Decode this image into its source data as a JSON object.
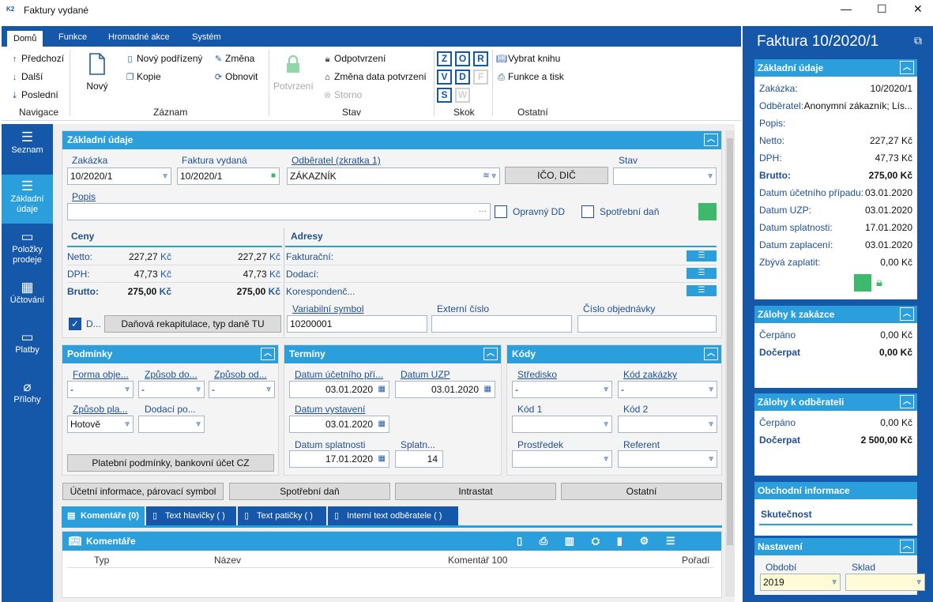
{
  "window": {
    "title": "Faktury vydané",
    "app_icon": "K2",
    "min": "—",
    "max": "☐",
    "close": "✕"
  },
  "ribbon": {
    "tabs": [
      "Domů",
      "Funkce",
      "Hromadné akce",
      "Systém"
    ],
    "nav": {
      "prev": "Předchozí",
      "next": "Další",
      "last": "Poslední",
      "group": "Navigace"
    },
    "record": {
      "new": "Nový",
      "new_sub": "Nový podřízený",
      "copy": "Kopie",
      "change": "Změna",
      "refresh": "Obnovit",
      "group": "Záznam"
    },
    "state": {
      "confirm": "Potvrzení",
      "unconfirm": "Odpotvrzení",
      "change_date": "Změna data potvrzení",
      "storno": "Storno",
      "group": "Stav"
    },
    "step": {
      "letters": [
        "Z",
        "O",
        "R",
        "V",
        "D",
        "F",
        "S",
        "W"
      ],
      "group": "Skok"
    },
    "other": {
      "choose_book": "Vybrat knihu",
      "func_print": "Funkce a tisk",
      "group": "Ostatní"
    }
  },
  "leftnav": [
    {
      "label": "Seznam",
      "icon": "☰"
    },
    {
      "label": "Základní údaje",
      "icon": "☰"
    },
    {
      "label": "Položky prodeje",
      "icon": "▭"
    },
    {
      "label": "Účtování",
      "icon": "▦"
    },
    {
      "label": "Platby",
      "icon": "▭"
    },
    {
      "label": "Přílohy",
      "icon": "⌀"
    }
  ],
  "basic": {
    "header": "Základní údaje",
    "zakazka_label": "Zakázka",
    "zakazka": "10/2020/1",
    "faktura_label": "Faktura vydaná",
    "faktura": "10/2020/1",
    "odberatel_label": "Odběratel (zkratka 1)",
    "odberatel": "ZÁKAZNÍK",
    "ico_btn": "IČO, DIČ",
    "stav_label": "Stav",
    "stav": "",
    "popis_label": "Popis",
    "popis": "",
    "opravny": "Opravný DD",
    "spotrebni": "Spotřební daň",
    "ceny": "Ceny",
    "adresy": "Adresy",
    "prices": [
      {
        "k": "Netto:",
        "v1": "227,27",
        "v2": "227,27"
      },
      {
        "k": "DPH:",
        "v1": "47,73",
        "v2": "47,73"
      },
      {
        "k": "Brutto:",
        "v1": "275,00",
        "v2": "275,00"
      }
    ],
    "currency": "Kč",
    "addresses": [
      "Fakturační:",
      "Dodací:",
      "Korespondenč..."
    ],
    "d_label": "D...",
    "rekap_btn": "Daňová rekapitulace, typ daně TU",
    "vs_label": "Variabilní symbol",
    "vs": "10200001",
    "ext_label": "Externí číslo",
    "ext": "",
    "obj_label": "Číslo objednávky",
    "obj": ""
  },
  "podminky": {
    "header": "Podmínky",
    "forma_label": "Forma obje...",
    "forma": "-",
    "zpusob_do_label": "Způsob do...",
    "zpusob_do": "-",
    "zpusob_od_label": "Způsob od...",
    "zpusob_od": "-",
    "zpusob_pl_label": "Způsob pla...",
    "zpusob_pl": "Hotově",
    "dodaci_label": "Dodací po...",
    "dodaci": "",
    "btn": "Platební podmínky, bankovní účet CZ"
  },
  "terminy": {
    "header": "Termíny",
    "ucet_label": "Datum účetního pří...",
    "ucet": "03.01.2020",
    "uzp_label": "Datum UZP",
    "uzp": "03.01.2020",
    "vyst_label": "Datum vystavení",
    "vyst": "03.01.2020",
    "spl_label": "Datum splatnosti",
    "spl": "17.01.2020",
    "splatn_label": "Splatn...",
    "splatn": "14"
  },
  "kody": {
    "header": "Kódy",
    "stredisko_label": "Středisko",
    "stredisko": "-",
    "kod_zak_label": "Kód zakázky",
    "kod_zak": "-",
    "kod1_label": "Kód 1",
    "kod1": "",
    "kod2_label": "Kód 2",
    "kod2": "",
    "prostredek_label": "Prostředek",
    "prostredek": "",
    "referent_label": "Referent",
    "referent": ""
  },
  "buttons": {
    "ucetni": "Účetní informace, párovací symbol",
    "spotrebni": "Spotřební daň",
    "intrastat": "Intrastat",
    "ostatni": "Ostatní"
  },
  "tabs": [
    "Komentáře (0)",
    "Text hlavičky ( )",
    "Text patičky ( )",
    "Interní text odběratele ( )"
  ],
  "comments": {
    "header": "Komentáře",
    "cols": [
      "Typ",
      "Název",
      "Komentář 100",
      "Pořadí"
    ]
  },
  "right": {
    "title": "Faktura 10/2020/1",
    "basic_header": "Základní údaje",
    "rows": [
      {
        "k": "Zakázka:",
        "v": "10/2020/1"
      },
      {
        "k": "Odběratel:",
        "v": "Anonymní zákazník; Lís..."
      },
      {
        "k": "Popis:",
        "v": ""
      },
      {
        "k": "Netto:",
        "v": "227,27 Kč"
      },
      {
        "k": "DPH:",
        "v": "47,73 Kč"
      },
      {
        "k": "Brutto:",
        "v": "275,00 Kč",
        "b": true
      },
      {
        "k": "Datum účetního případu:",
        "v": "03.01.2020"
      },
      {
        "k": "Datum UZP:",
        "v": "03.01.2020"
      },
      {
        "k": "Datum splatnosti:",
        "v": "17.01.2020"
      },
      {
        "k": "Datum zaplacení:",
        "v": "03.01.2020"
      },
      {
        "k": "Zbývá zaplatit:",
        "v": "0,00 Kč"
      }
    ],
    "zal_zak_header": "Zálohy k zakázce",
    "zal_zak": [
      {
        "k": "Čerpáno",
        "v": "0,00 Kč"
      },
      {
        "k": "Dočerpat",
        "v": "0,00 Kč",
        "b": true
      }
    ],
    "zal_odb_header": "Zálohy k odběrateli",
    "zal_odb": [
      {
        "k": "Čerpáno",
        "v": "0,00 Kč"
      },
      {
        "k": "Dočerpat",
        "v": "2 500,00 Kč",
        "b": true
      }
    ],
    "obch_header": "Obchodní informace",
    "skutecnost": "Skutečnost",
    "nast_header": "Nastavení",
    "obdobi_label": "Období",
    "obdobi": "2019",
    "sklad_label": "Sklad",
    "sklad": ""
  }
}
